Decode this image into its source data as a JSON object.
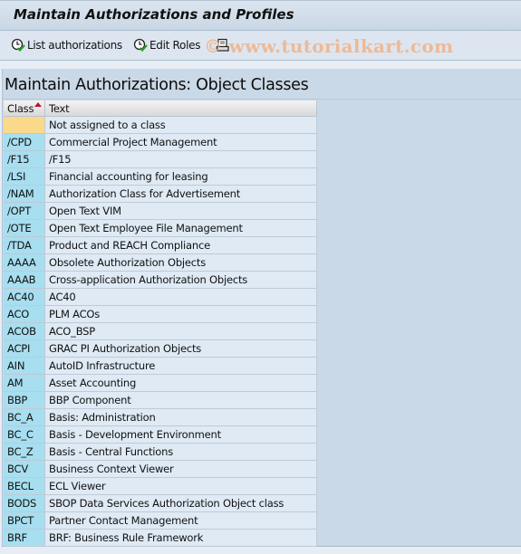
{
  "window": {
    "title": "Maintain Authorizations and Profiles"
  },
  "toolbar": {
    "list_authorizations_label": "List authorizations",
    "list_authorizations_icon": "clock-check-icon",
    "edit_roles_label": "Edit Roles",
    "edit_roles_icon": "clock-check-icon",
    "print_icon": "printer-icon"
  },
  "watermark": "© www.tutorialkart.com",
  "main": {
    "heading": "Maintain Authorizations: Object Classes",
    "table": {
      "columns": [
        {
          "label": "Class",
          "sorted": "ascending"
        },
        {
          "label": "Text"
        }
      ],
      "rows": [
        {
          "class": "",
          "text": "Not assigned to a class"
        },
        {
          "class": "/CPD",
          "text": "Commercial Project Management"
        },
        {
          "class": "/F15",
          "text": "/F15"
        },
        {
          "class": "/LSI",
          "text": "Financial accounting for leasing"
        },
        {
          "class": "/NAM",
          "text": "Authorization Class for Advertisement"
        },
        {
          "class": "/OPT",
          "text": "Open Text VIM"
        },
        {
          "class": "/OTE",
          "text": "Open Text Employee File Management"
        },
        {
          "class": "/TDA",
          "text": "Product and REACH Compliance"
        },
        {
          "class": "AAAA",
          "text": "Obsolete Authorization Objects"
        },
        {
          "class": "AAAB",
          "text": "Cross-application Authorization Objects"
        },
        {
          "class": "AC40",
          "text": "AC40"
        },
        {
          "class": "ACO",
          "text": "PLM ACOs"
        },
        {
          "class": "ACOB",
          "text": "ACO_BSP"
        },
        {
          "class": "ACPI",
          "text": "GRAC PI Authorization Objects"
        },
        {
          "class": "AIN",
          "text": "AutoID Infrastructure"
        },
        {
          "class": "AM",
          "text": "Asset Accounting"
        },
        {
          "class": "BBP",
          "text": "BBP Component"
        },
        {
          "class": "BC_A",
          "text": "Basis: Administration"
        },
        {
          "class": "BC_C",
          "text": "Basis - Development Environment"
        },
        {
          "class": "BC_Z",
          "text": "Basis - Central Functions"
        },
        {
          "class": "BCV",
          "text": "Business Context Viewer"
        },
        {
          "class": "BECL",
          "text": "ECL Viewer"
        },
        {
          "class": "BODS",
          "text": "SBOP Data Services Authorization Object class"
        },
        {
          "class": "BPCT",
          "text": "Partner Contact Management"
        },
        {
          "class": "BRF",
          "text": "BRF: Business Rule Framework"
        }
      ]
    }
  },
  "colors": {
    "class_cell": "#a7def0",
    "unassigned_cell": "#fbd98a",
    "text_cell": "#dfeaf5",
    "panel_bg": "#cad9e7",
    "sort_arrow": "#c0142a"
  }
}
